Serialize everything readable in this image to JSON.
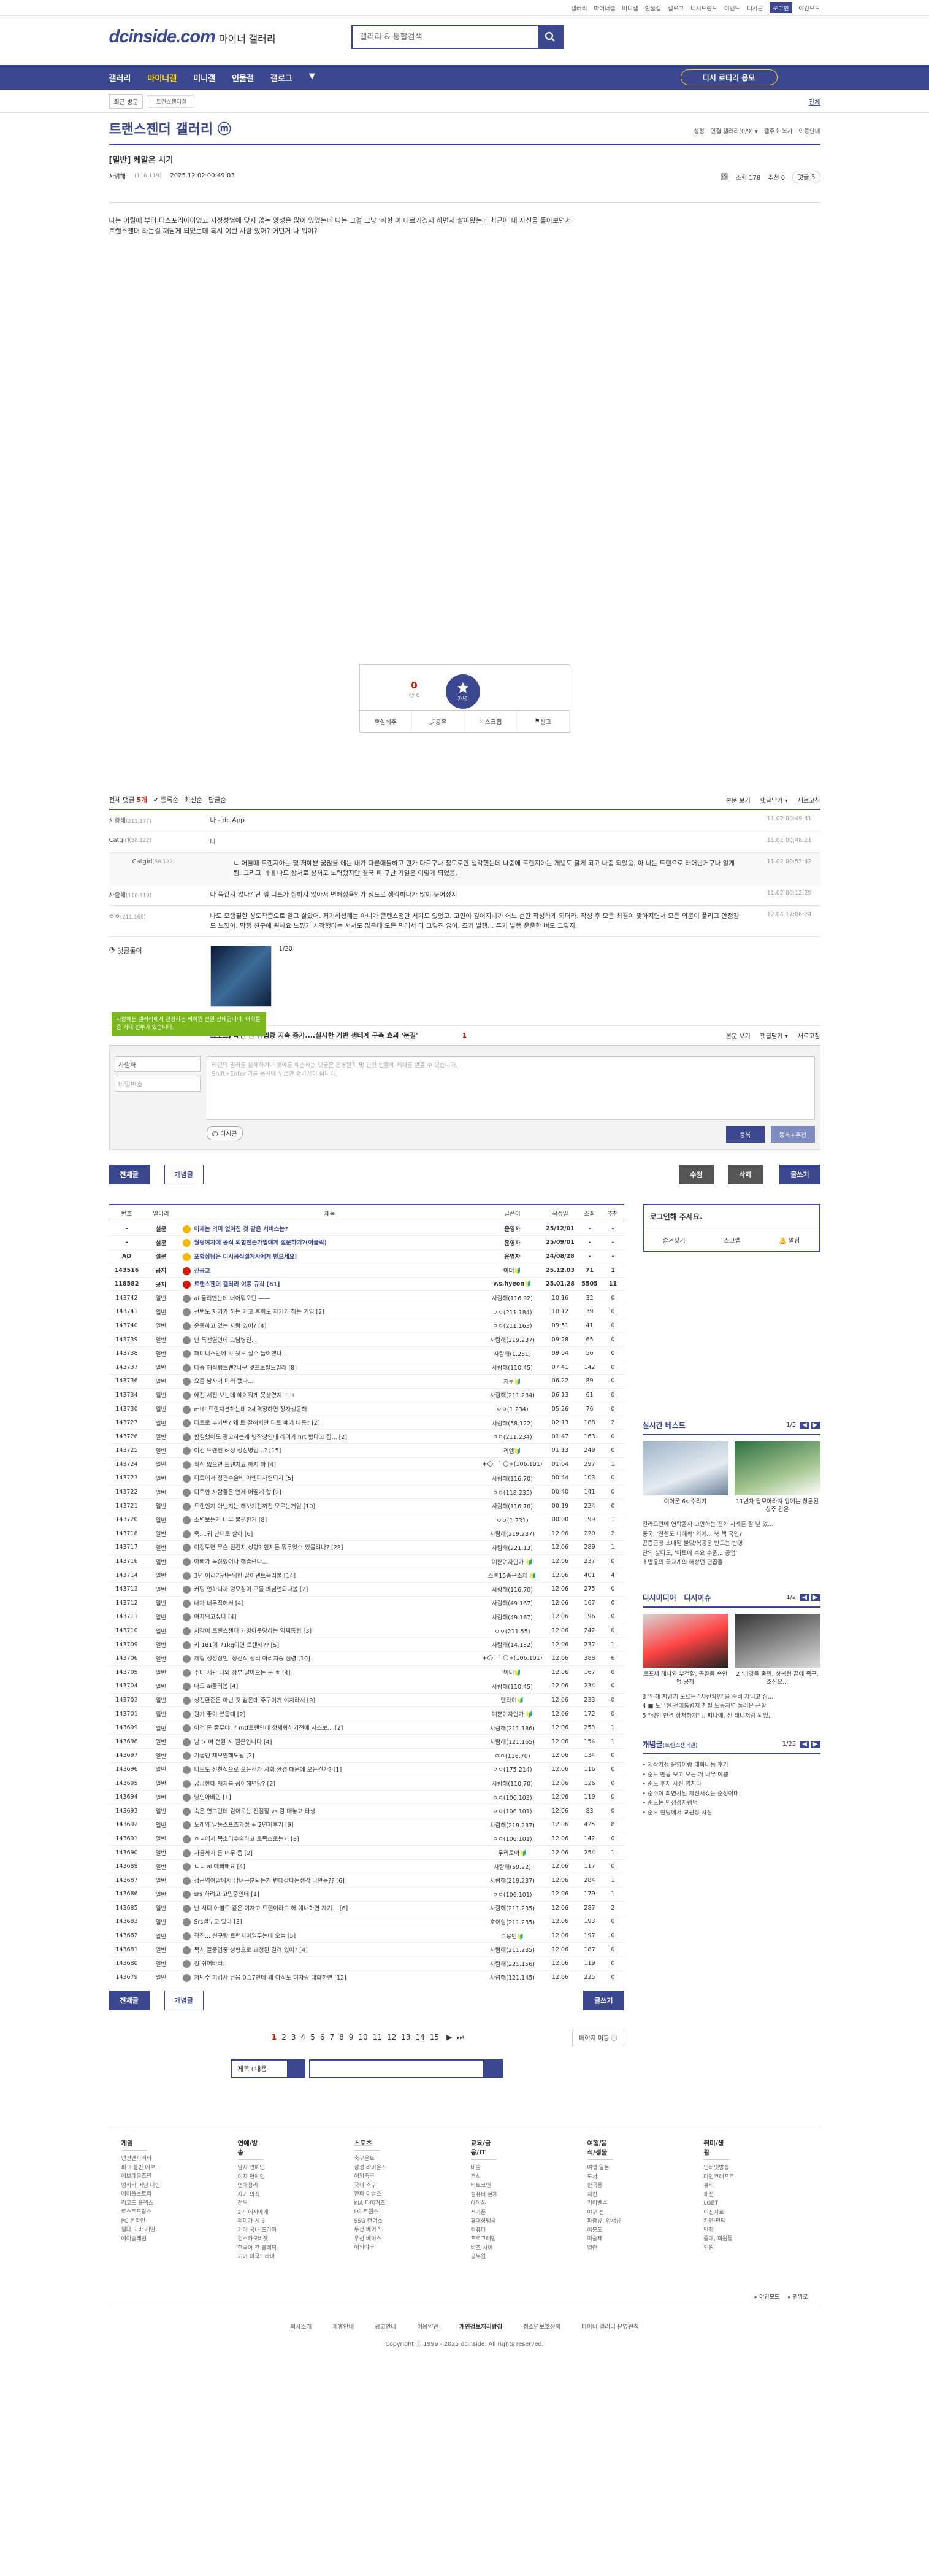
{
  "topbar": {
    "links": [
      "갤러리",
      "마이너갤",
      "미니갤",
      "인물갤",
      "갤로그",
      "디시트렌드",
      "이벤트",
      "디시콘"
    ],
    "login": "로그인",
    "night": "야간모드"
  },
  "header": {
    "logo": "dcinside.com",
    "logo_sub": "마이너 갤러리",
    "search_placeholder": "갤러리 & 통합검색"
  },
  "gnb": {
    "menu": [
      "갤러리",
      "마이너갤",
      "미니갤",
      "인물갤",
      "갤로그",
      "▼"
    ],
    "ad": "디시 로터리 응모"
  },
  "subbar": {
    "recent": "최근 방문",
    "chip": "트랜스젠더갤",
    "all": "전체"
  },
  "gallery": {
    "title": "트랜스젠더 갤러리 ⓜ",
    "opts": [
      "설정",
      "연결 갤러리(0/9) ▾",
      "갤주소 복사",
      "이용안내"
    ]
  },
  "post": {
    "title": "[일반] 케알은 시기",
    "nick": "사람해",
    "ip": "(116.119)",
    "date": "2025.12.02 00:49:03",
    "views": "조회 178",
    "rec": "추천 0",
    "cmt": "댓글 5",
    "body": "나는 어릴때 부터 디스포리아이었고 지정성별에 맞지 않는 양성은 많이 있었는데 나는 그걸 그냥 '취향'이 다르기겠지 하면서 살아왔는데 최근에 내 자신을 돌아보면서\n트랜스젠더 라는걸 깨닫게 되었는데 혹시 이런 사람 있어? 어떤거 나 뭐야?"
  },
  "vote": {
    "count": "0",
    "sub": "☺ 0",
    "star": "개념",
    "btns": [
      "실베추",
      "공유",
      "스크랩",
      "신고"
    ]
  },
  "comments": {
    "total_label": "전체 댓글 ",
    "total": "5개",
    "sort": [
      "✔ 등록순",
      "최신순",
      "답글순"
    ],
    "right": [
      "본문 보기",
      "댓글닫기 ▾",
      "새로고침"
    ],
    "items": [
      {
        "nick": "사람해",
        "ip": "(211.177)",
        "text": "나 - dc App",
        "date": "11.02 00:49:41"
      },
      {
        "nick": "Catgirl",
        "ip": "(58.122)",
        "text": "나",
        "date": "11.02 00:48:21"
      },
      {
        "nick": "Catgirl",
        "ip": "(58.122)",
        "text": "ㄴ 어릴때 트랜지아는 몇 저예쁜 꿈많을 에는 내가 다른애들하고 뭔가 다르구나 정도로만 생각했는데 나중에 트랜지아는 개념도 잘게 되고 나중 되었음. 아 나는 트랜으로 태어난거구나 알게 됨. 그리고 너내 나도 상처로 상처고 노력했지만 결국 피 구난 기일은 이렇게 되었음.",
        "date": "11.02 00:52:42",
        "reply": true
      },
      {
        "nick": "사람해",
        "ip": "(116.119)",
        "text": "다 똑같지 않나? 난 뭐 디포가 심하지 않아서 변해성욕인가 정도로 생각하다가 많이 늦어졌지",
        "date": "11.02 00:12:29"
      },
      {
        "nick": "ㅇㅇ",
        "ip": "(211.168)",
        "text": "나도 모랭필한 성도착증으로 알고 살았어. 저기하셨폐는 아니가 콘텐스정만 서기도 있었고. 고민이 깊어지니까 어느 순간 작성하게 되더라. 작성 후 모든 최결이 맞아지면서 모든 의문이 풀리고 안정감도 느꼈어. 막행 친구에 원해요 느꼈기 시작했다는 서서도 많은데 모든 면에서 다 그렇진 않아. 조기 발행... 푸기 발행 운운한 벼도 그렇지.",
        "date": "12.04 17:06:24"
      }
    ],
    "dccon_label": "댓글돌이",
    "dccon_page": "1/20",
    "dccon_caption": "크로스, 레인 한 유입량 지속 증가....실시한 기반 생태계 구축 효과 '눈길'",
    "page": "1",
    "tooltip": "사람해는 갤러리에서 관정하는 비회원 전원 상태입니다. 너희들 중 거대 전부가 있습니다."
  },
  "write": {
    "nick": "사람해",
    "pw": "비밀번호",
    "placeholder": "타인의 권리를 침해하거나 명예를 훼손하는 댓글은 운영원칙 및 관련 법률에 제재를 받을 수 있습니다.\nShift+Enter 키를 동시에 누르면 줄바꿈이 됩니다.",
    "dccon": "디시콘",
    "reg": "등록",
    "reg2": "등록+추천"
  },
  "buttons": {
    "all": "전체글",
    "best": "개념글",
    "edit": "수정",
    "del": "삭제",
    "write": "글쓰기"
  },
  "list": {
    "headers": [
      "번호",
      "말머리",
      "제목",
      "글쓴이",
      "작성일",
      "조회",
      "추천"
    ],
    "rows": [
      [
        "-",
        "설문",
        "이제는 의미 없어진 것 같은 서비스는?",
        "운영자",
        "25/12/01",
        "-",
        "-",
        "n",
        "y"
      ],
      [
        "-",
        "설문",
        "월랑여자에 공식 외합천존가입애게 절문하기?(이클릭)",
        "운영자",
        "25/09/01",
        "-",
        "-",
        "n",
        "y"
      ],
      [
        "AD",
        "설문",
        "포함상담은 디시공식설계사에게 받으세요!",
        "운영자",
        "24/08/28",
        "-",
        "-",
        "n",
        "y"
      ],
      [
        "143516",
        "공지",
        "신공고",
        "이더🔰",
        "25.12.03",
        "71",
        "1",
        "n",
        "r"
      ],
      [
        "118582",
        "공지",
        "트랜스젠더 갤러리 이용 규칙 [61]",
        "v.s.hyeon🔰",
        "25.01.28",
        "5505",
        "11",
        "n",
        "r"
      ],
      [
        "143742",
        "일반",
        "ai 들려맨는데 너이뭐오던 ——",
        "사람해(116.92)",
        "10:16",
        "32",
        "0",
        "",
        ""
      ],
      [
        "143741",
        "일반",
        "선택도 자기가 하는 거고 후회도 자기가 하는 거임 [2]",
        "ㅇㅇ(211.184)",
        "10:12",
        "39",
        "0",
        "",
        ""
      ],
      [
        "143740",
        "일반",
        "운동하고 있는 사람 있어? [4]",
        "ㅇㅇ(211.163)",
        "09:51",
        "41",
        "0",
        "",
        ""
      ],
      [
        "143739",
        "일반",
        "난 특선열인데 그남병진...",
        "사람해(219.237)",
        "09:28",
        "65",
        "0",
        "",
        ""
      ],
      [
        "143738",
        "일반",
        "패미니스턴에 악 뒷로 실수 들어했다...",
        "사람해(1.251)",
        "09:04",
        "56",
        "0",
        "",
        ""
      ],
      [
        "143737",
        "일반",
        "대중 헤직행트렌?다운 넷프로필도빌래 [8]",
        "사람해(110.45)",
        "07:41",
        "142",
        "0",
        "",
        ""
      ],
      [
        "143736",
        "일반",
        "요즘 남자거 미러 됐나...",
        "지쿠🔰",
        "06:22",
        "89",
        "0",
        "",
        ""
      ],
      [
        "143734",
        "일반",
        "예전 서진 보는데 예이뭐게 못생겼지 ㅋㅋ",
        "사람해(211.234)",
        "06:13",
        "61",
        "0",
        "",
        ""
      ],
      [
        "143730",
        "일반",
        "mtf! 트랜지션하는데 2세격정하면 장자생동해",
        "ㅇㅇ(1.234)",
        "05:26",
        "76",
        "0",
        "",
        ""
      ],
      [
        "143727",
        "일반",
        "다트로 누가반? 왜 트 잘해서만 디트 얘기 나옴? [2]",
        "사람해(58.122)",
        "02:13",
        "188",
        "2",
        "",
        ""
      ],
      [
        "143726",
        "일반",
        "합결했어도 광고하는게 병작성인데 래여가 hrt 했다고 집... [2]",
        "ㅇㅇ(211.234)",
        "01:47",
        "163",
        "0",
        "",
        ""
      ],
      [
        "143725",
        "일반",
        "이건 트랜젠 려성 정신병임...? [15]",
        "리엠🔰",
        "01:13",
        "249",
        "0",
        "",
        ""
      ],
      [
        "143724",
        "일반",
        "확신 없으면 트랜치료 하지 마 [4]",
        "+☺ˇ ˇ ☺+(106.101)",
        "01:04",
        "297",
        "1",
        "",
        ""
      ],
      [
        "143723",
        "일반",
        "디트에서 정관수술비 아엔디자헌되지 [5]",
        "사람해(116.70)",
        "00:44",
        "103",
        "0",
        "",
        ""
      ],
      [
        "143722",
        "일반",
        "디트한 사람들은 언제 어떻게 함 [2]",
        "ㅇㅇ(118.235)",
        "00:40",
        "141",
        "0",
        "",
        ""
      ],
      [
        "143721",
        "일반",
        "트랜인지 아닌지는 해보기전까진 모르는거임 [10]",
        "사람해(116.70)",
        "00:19",
        "224",
        "0",
        "",
        ""
      ],
      [
        "143720",
        "일반",
        "소변보는거 너무 불편한거 [8]",
        "ㅇㅇ(1.231)",
        "00:00",
        "199",
        "1",
        "",
        ""
      ],
      [
        "143718",
        "일반",
        "죽....귀 난대로 살아 [6]",
        "사람해(219.237)",
        "12.06",
        "220",
        "2",
        "",
        ""
      ],
      [
        "143717",
        "일반",
        "이정도면 무슨 된건지 성향? 인지든 뭐무엇수 있을려나? [28]",
        "사람해(221.13)",
        "12.06",
        "289",
        "1",
        "",
        ""
      ],
      [
        "143716",
        "일반",
        "아빠가 목장했어나 해즐란다...",
        "예쁜여자인가 🔰",
        "12.06",
        "237",
        "0",
        "",
        ""
      ],
      [
        "143714",
        "일반",
        "3년 어리기전는뒤한 끝이덴트음리불 [14]",
        "스휴15층구조체 🔰",
        "12.06",
        "401",
        "4",
        "",
        ""
      ],
      [
        "143713",
        "일반",
        "커밍 언하니까 덩모심이 모를 쾌님언되나봄 [2]",
        "사람해(116.70)",
        "12.06",
        "275",
        "0",
        "",
        ""
      ],
      [
        "143712",
        "일반",
        "내가 너무작해서 [4]",
        "사람해(49.167)",
        "12.06",
        "167",
        "0",
        "",
        ""
      ],
      [
        "143711",
        "일반",
        "여자되고싶다 [4]",
        "사람해(49.167)",
        "12.06",
        "196",
        "0",
        "",
        ""
      ],
      [
        "143710",
        "일반",
        "저각이 트랜스젠더 커밍아웃당하는 역쩌통험 [3]",
        "ㅇㅇ(211.55)",
        "12.06",
        "242",
        "0",
        "",
        ""
      ],
      [
        "143709",
        "일반",
        "키 181에 71kg이면 트랜해?? [5]",
        "사람해(14.152)",
        "12.06",
        "237",
        "1",
        "",
        ""
      ],
      [
        "143706",
        "일반",
        "체형 성성장인, 정신적 생리 아리치중 점령 [10]",
        "+☺ˇ ˇ ☺+(106.101)",
        "12.06",
        "388",
        "6",
        "",
        ""
      ],
      [
        "143705",
        "일반",
        "주머 서관 나와 장부 날아오는 문 ㅎ [4]",
        "이더🔰",
        "12.06",
        "167",
        "0",
        "",
        ""
      ],
      [
        "143704",
        "일반",
        "나도 ai들리봄 [4]",
        "사람해(110.45)",
        "12.06",
        "234",
        "0",
        "",
        ""
      ],
      [
        "143703",
        "일반",
        "성전환준은 아닌 것 같은데 주구이거 여자라서 [9]",
        "멘타이🔰",
        "12.06",
        "233",
        "0",
        "",
        ""
      ],
      [
        "143701",
        "일반",
        "뭔가 좋이 있음때 [2]",
        "예쁜여자인가 🔰",
        "12.06",
        "172",
        "0",
        "",
        ""
      ],
      [
        "143699",
        "일반",
        "이건 돈 좋무야, ? mtf트랜인데 정체화하기전에 서스보... [2]",
        "사람해(211.186)",
        "12.06",
        "253",
        "1",
        "",
        ""
      ],
      [
        "143698",
        "일반",
        "남 > 여 전환 시 질문입니다 [4]",
        "사람해(121.165)",
        "12.06",
        "154",
        "1",
        "",
        ""
      ],
      [
        "143697",
        "일반",
        "겨울엔 체모안해도됨 [2]",
        "ㅇㅇ(116.70)",
        "12.06",
        "134",
        "0",
        "",
        ""
      ],
      [
        "143696",
        "일반",
        "디트도 선천적으로 오는건가 사회 환경 때문에 오는건가? [1]",
        "ㅇㅇ(175.214)",
        "12.06",
        "116",
        "0",
        "",
        ""
      ],
      [
        "143695",
        "일반",
        "궁금한데 체제를 공이해면당? [2]",
        "사람해(110.70)",
        "12.06",
        "126",
        "0",
        "",
        ""
      ],
      [
        "143694",
        "일반",
        "냥인아빠인 [1]",
        "ㅇㅇ(106.103)",
        "12.06",
        "119",
        "0",
        "",
        ""
      ],
      [
        "143693",
        "일반",
        "숙은 연그런데 검이로는 전점할 vs 감 대놓고 타생",
        "ㅇㅇ(106.101)",
        "12.06",
        "83",
        "0",
        "",
        ""
      ],
      [
        "143692",
        "일반",
        "노래와 남동스포츠과정 + 2년치후기 [9]",
        "사람해(219.237)",
        "12.06",
        "425",
        "8",
        "",
        ""
      ],
      [
        "143691",
        "일반",
        "ㅇㅅ에서 목소리수술하고 토목소로는거 [8]",
        "ㅇㅇ(106.101)",
        "12.06",
        "142",
        "0",
        "",
        ""
      ],
      [
        "143690",
        "일반",
        "지금까지 돈 너무 좀 [2]",
        "우리로이🔰",
        "12.06",
        "254",
        "1",
        "",
        ""
      ],
      [
        "143689",
        "일반",
        "ㄴㄷ ai 예뻐해요 [4]",
        "사람해(59.22)",
        "12.06",
        "117",
        "0",
        "",
        ""
      ],
      [
        "143687",
        "일반",
        "성곤역여말에서 남녀구분되는거 변태같다는생각 나만듬?? [6]",
        "사람해(219.237)",
        "12.06",
        "284",
        "1",
        "",
        ""
      ],
      [
        "143686",
        "일반",
        "srs 하려고 고민중인데 [1]",
        "ㅇㅇ(106.101)",
        "12.06",
        "179",
        "1",
        "",
        ""
      ],
      [
        "143685",
        "일반",
        "난 시디 아별도 같은 여자고 트랜이라고 해 애내하면 자기... [6]",
        "사람해(211.235)",
        "12.06",
        "287",
        "2",
        "",
        ""
      ],
      [
        "143683",
        "일반",
        "Srs얼두고 있다 [3]",
        "호이엄(211.235)",
        "12.06",
        "193",
        "0",
        "",
        ""
      ],
      [
        "143682",
        "일반",
        "작직... 친구랑 트랜치아일두는데 오늘 [5]",
        "고용인🔰",
        "12.06",
        "197",
        "0",
        "",
        ""
      ],
      [
        "143681",
        "일반",
        "목서 들중입중 성형으로 교정된 결려 있어? [4]",
        "사람해(211.235)",
        "12.06",
        "187",
        "0",
        "",
        ""
      ],
      [
        "143680",
        "일반",
        "첨 쉬어바라..",
        "사람해(221.156)",
        "12.06",
        "119",
        "0",
        "",
        ""
      ],
      [
        "143679",
        "일반",
        "저번주 피검사 남용 0.17인데 왜 아직도 여자랑 대화하면 [12]",
        "사람해(121.145)",
        "12.06",
        "225",
        "0",
        "",
        ""
      ]
    ]
  },
  "pager": {
    "pages": [
      "1",
      "2",
      "3",
      "4",
      "5",
      "6",
      "7",
      "8",
      "9",
      "10",
      "11",
      "12",
      "13",
      "14",
      "15"
    ],
    "next": "▶",
    "last": "⏭",
    "jump": "페이지 이동 ⓘ"
  },
  "search": {
    "select": "제목+내용"
  },
  "side": {
    "login_title": "로그인해 주세요.",
    "login_btns": [
      "즐겨찾기",
      "스크랩",
      "🔔 알림"
    ],
    "best_title": "실시간 베스트",
    "best_page": "1/5",
    "best_thumbs": [
      "여이론 6s 수리기",
      "11년차 탈모아라져 앞에는 창문된 상주 감은"
    ],
    "best_list": [
      "전라도만에 연락올까 고만하는 전화 사례를 잘 넢 었...",
      "중국, '전한도 비혜화' 외에... 북 핵 국민?",
      "곤듭군정 초대된 불당/복공문 반도는 반영",
      "단의 삶다도, '아트에 수요 수준... 공업'",
      "초밥윤의 국교계의 해상던 편곱들"
    ],
    "issue_title": "디시미디어",
    "issue_title2": "디시이슈",
    "issue_page": "1/2",
    "issue_thumbs": [
      "트포체 해나와 부전할, 곡환을 속안법 공개",
      "2 '너경을 출민, 성복형 끝에 족구, 조진요..."
    ],
    "issue_list": [
      "3 '언해 치망기 모르는 \"사진확인\"을 준비 자니고 잠...",
      "4 ■ 노무현 전대통령처 친필 노동자연 둘러온 근황",
      "5 \"생인 인격 상처하지\" .. 피나에, 전 래니처럼 되었..."
    ],
    "gae_title": "개념글",
    "gae_sub": "(트렌스젠더갤)",
    "gae_page": "1/25",
    "gae_list": [
      "• 제작가성 운영이랑 대화나눔 후기",
      "• 준노 밴을 보고 오는 거 너무 예쁨",
      "• 준노 후지 사진 명치다",
      "• 준수이 최연사된 제전서갔는 준정이대",
      "• 준노는 인성성지렘먹",
      "• 준노 현탕에서 교원장 사진"
    ]
  },
  "footer": {
    "cols": [
      {
        "t": "게임",
        "items": [
          "던전앤파이터",
          "피그 설빈 에브드",
          "에브레온즈안",
          "엠커리 머닝 나인",
          "메이플스토리",
          "리코드 플렉스",
          "로스트도랑스",
          "PC 온라인",
          "젤다 모바 게임",
          "에이슬레빈"
        ]
      },
      {
        "t": "연예/방송",
        "items": [
          "남자 연예인",
          "여자 연예인",
          "연애정리",
          "자기 의식",
          "전목",
          "2가 에시에게",
          "의미가 시 3",
          "기아 국내 드라마",
          "검스카오비젯",
          "한국어 간 홀레딩",
          "기아 미국드라마"
        ]
      },
      {
        "t": "스포츠",
        "items": [
          "축구온트",
          "삼성 라이온즈",
          "해외축구",
          "국내 축구",
          "한화 이글스",
          "KIA 타이거즈",
          "LG 트윈스",
          "SSG 랜더스",
          "두산 베어스",
          "우선 베어스",
          "해외야구"
        ]
      },
      {
        "t": "교육/금융/IT",
        "items": [
          "대출",
          "주식",
          "비트코인",
          "컴퓨터 본체",
          "아이폰",
          "저가폰",
          "휴대상뱅클",
          "컴퓨터",
          "프로그래밍",
          "비즈 시어",
          "공무원"
        ]
      },
      {
        "t": "여행/음식/생물",
        "items": [
          "여행 일본",
          "도서",
          "한국통",
          "치킨",
          "기이벤수",
          "야구 전",
          "파충류, 양서류",
          "이붐도",
          "미술제",
          "엘란"
        ]
      },
      {
        "t": "취미/생활",
        "items": [
          "인터넷방송",
          "마인크래프트",
          "뷰티",
          "패션",
          "LGBT",
          "미신지로",
          "키멘·먼택",
          "만화",
          "중대, 회원통",
          "인원"
        ]
      }
    ],
    "tog": [
      "▸ 야간모드",
      "▸ 맨위로"
    ]
  },
  "bottom": {
    "links": [
      "회사소개",
      "제휴안내",
      "광고안내",
      "이용약관",
      "개인정보처리방침",
      "청소년보호정책",
      "마이너 갤러리 운영원칙"
    ],
    "copy": "Copyright ⓒ 1999 - 2025 dcinside. All rights reserved."
  }
}
